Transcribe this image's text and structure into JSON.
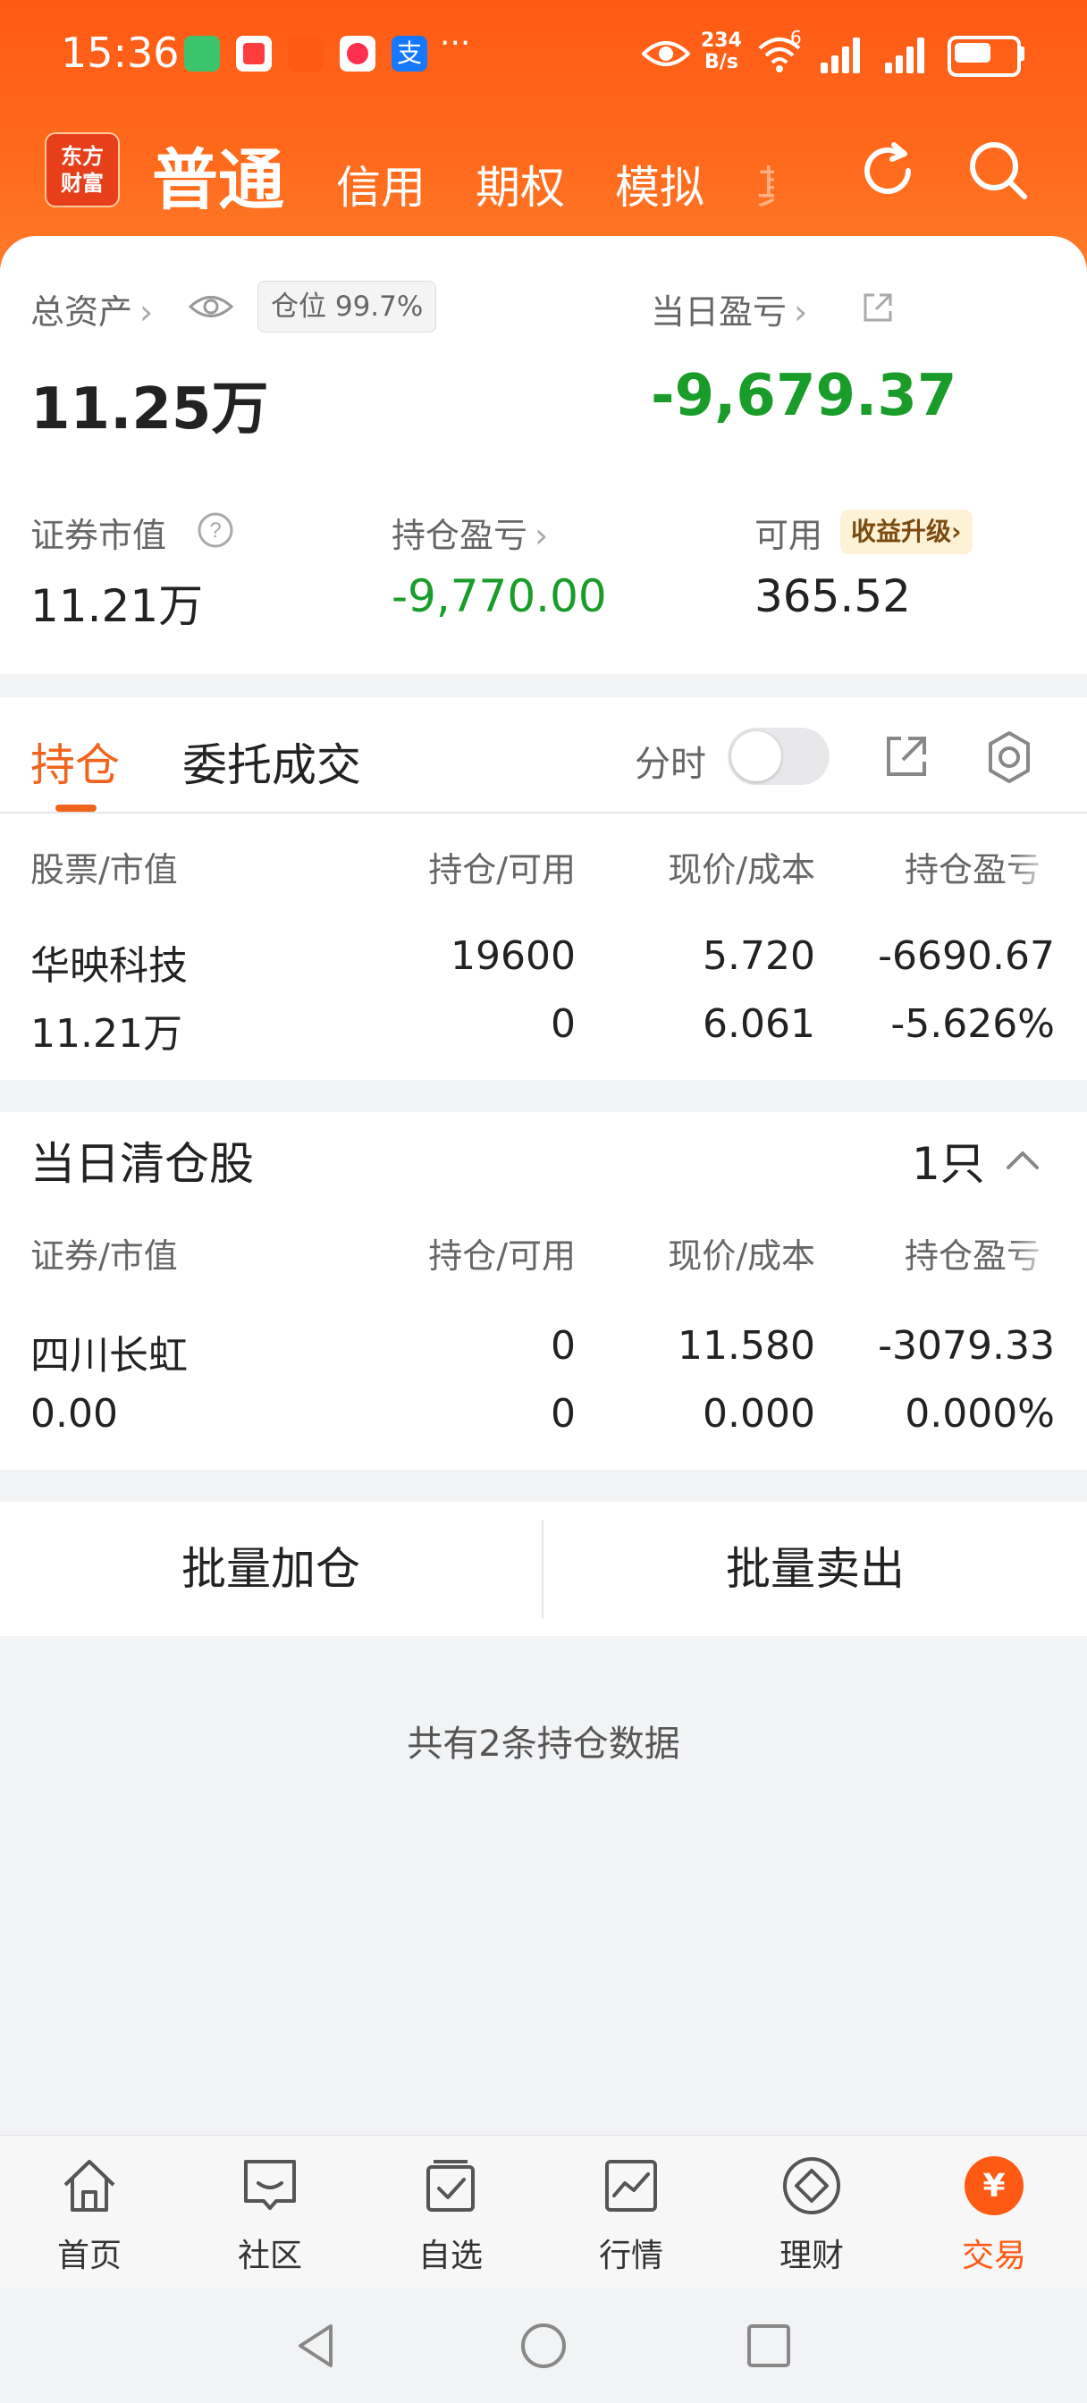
{
  "status_bar": {
    "time": "15:36",
    "net_speed_value": "234",
    "net_speed_unit": "B/s",
    "dots": "···",
    "wifi_tag": "6"
  },
  "header": {
    "logo_text": "东方\n财富",
    "tabs": [
      "普通",
      "信用",
      "期权",
      "模拟",
      "其"
    ],
    "active_tab": "普通",
    "icons": [
      "refresh-icon",
      "search-icon"
    ]
  },
  "summary": {
    "total_assets_label": "总资产",
    "position_ratio": "仓位 99.7%",
    "total_assets_value": "11.25万",
    "daily_pnl_label": "当日盈亏",
    "daily_pnl_value": "-9,679.37",
    "market_value_label": "证券市值",
    "market_value": "11.21万",
    "holding_pnl_label": "持仓盈亏",
    "holding_pnl_value": "-9,770.00",
    "available_label": "可用",
    "upgrade_badge": "收益升级",
    "available_value": "365.52"
  },
  "holdings_tabs": {
    "tabs": [
      "持仓",
      "委托成交"
    ],
    "active": "持仓",
    "time_share_label": "分时",
    "time_share_on": false
  },
  "holdings_table": {
    "headers": [
      "股票/市值",
      "持仓/可用",
      "现价/成本",
      "持仓盈亏"
    ],
    "rows": [
      {
        "name": "华映科技",
        "market_value": "11.21万",
        "position": "19600",
        "available": "0",
        "price": "5.720",
        "cost": "6.061",
        "pnl": "-6690.67",
        "pnl_pct": "-5.626%"
      }
    ]
  },
  "cleared": {
    "title": "当日清仓股",
    "count": "1只",
    "headers": [
      "证券/市值",
      "持仓/可用",
      "现价/成本",
      "持仓盈亏"
    ],
    "rows": [
      {
        "name": "四川长虹",
        "market_value": "0.00",
        "position": "0",
        "available": "0",
        "price": "11.580",
        "cost": "0.000",
        "pnl": "-3079.33",
        "pnl_pct": "0.000%"
      }
    ]
  },
  "actions": {
    "batch_add": "批量加仓",
    "batch_sell": "批量卖出"
  },
  "footer_note": "共有2条持仓数据",
  "bottom_nav": {
    "items": [
      {
        "label": "首页",
        "icon": "home-icon"
      },
      {
        "label": "社区",
        "icon": "community-icon"
      },
      {
        "label": "自选",
        "icon": "watchlist-icon"
      },
      {
        "label": "行情",
        "icon": "market-chart-icon"
      },
      {
        "label": "理财",
        "icon": "wealth-icon"
      },
      {
        "label": "交易",
        "icon": "trade-icon"
      }
    ],
    "active": "交易"
  },
  "colors": {
    "brand_orange": "#ff5a14",
    "loss_green": "#1a9c2a",
    "active_tab": "#f0641e"
  }
}
